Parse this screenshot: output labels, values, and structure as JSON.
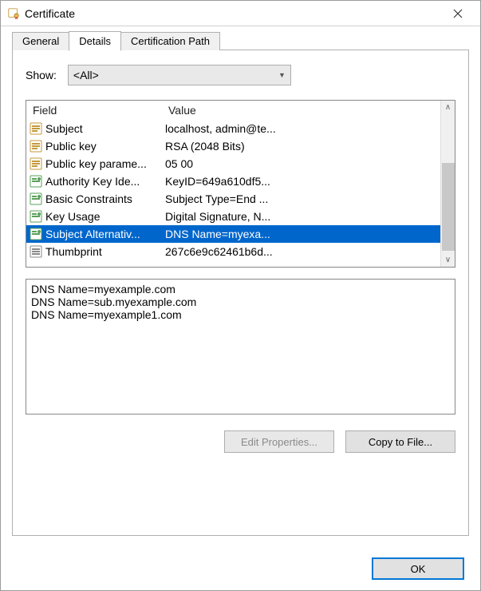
{
  "window": {
    "title": "Certificate"
  },
  "tabs": {
    "general": "General",
    "details": "Details",
    "certpath": "Certification Path"
  },
  "show": {
    "label": "Show:",
    "value": "<All>"
  },
  "columns": {
    "field": "Field",
    "value": "Value"
  },
  "rows": [
    {
      "icon": "field",
      "field": "Subject",
      "value": "localhost, admin@te...",
      "selected": false
    },
    {
      "icon": "field",
      "field": "Public key",
      "value": "RSA (2048 Bits)",
      "selected": false
    },
    {
      "icon": "field",
      "field": "Public key parame...",
      "value": "05 00",
      "selected": false
    },
    {
      "icon": "ext",
      "field": "Authority Key Ide...",
      "value": "KeyID=649a610df5...",
      "selected": false
    },
    {
      "icon": "ext",
      "field": "Basic Constraints",
      "value": "Subject Type=End ...",
      "selected": false
    },
    {
      "icon": "ext",
      "field": "Key Usage",
      "value": "Digital Signature, N...",
      "selected": false
    },
    {
      "icon": "ext",
      "field": "Subject Alternativ...",
      "value": "DNS Name=myexa...",
      "selected": true
    },
    {
      "icon": "thumb",
      "field": "Thumbprint",
      "value": "267c6e9c62461b6d...",
      "selected": false
    }
  ],
  "detail_text": "DNS Name=myexample.com\nDNS Name=sub.myexample.com\nDNS Name=myexample1.com",
  "buttons": {
    "edit": "Edit Properties...",
    "copy": "Copy to File...",
    "ok": "OK"
  }
}
